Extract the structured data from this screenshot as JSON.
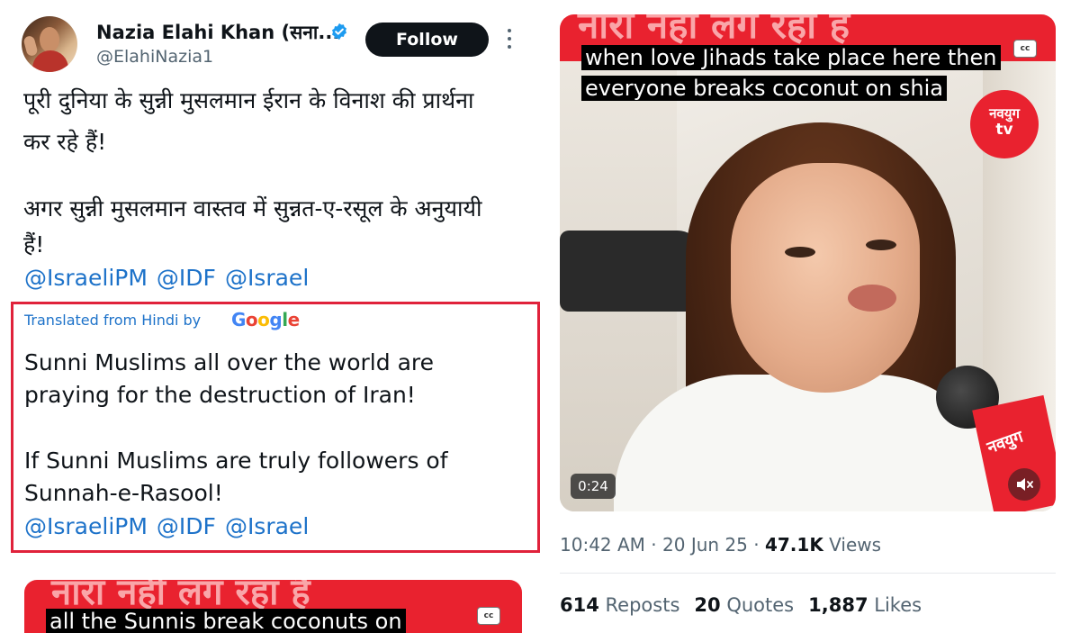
{
  "tweet": {
    "author_name": "Nazia Elahi Khan (सना...",
    "author_handle": "@ElahiNazia1",
    "follow_label": "Follow",
    "hindi_text": [
      "पूरी दुनिया के सुन्नी मुसलमान ईरान के विनाश की प्रार्थना",
      "कर रहे हैं!",
      "अगर सुन्नी मुसलमान वास्तव में सुन्नत-ए-रसूल के अनुयायी",
      "हैं!"
    ],
    "mentions": [
      "@IsraeliPM",
      "@IDF",
      "@Israel"
    ],
    "translated_label": "Translated from Hindi by",
    "translation_provider": "Google",
    "english_text": [
      "Sunni Muslims all over the world are",
      "praying for the destruction of Iran!",
      "If Sunni Muslims are truly followers of",
      "Sunnah-e-Rasool!"
    ]
  },
  "video": {
    "caption_line1": "when love Jihads take place here then",
    "caption_line2": "everyone breaks coconut on shia",
    "watermark_hindi": "नारा नहीं लग रहा है",
    "channel_logo_line1": "नवयुग",
    "channel_logo_line2": "tv",
    "mic_label": "नवयुग",
    "cc_label": "cc",
    "duration": "0:24"
  },
  "second_video": {
    "caption": "all the Sunnis break coconuts on",
    "watermark_hindi": "नारा नहीं लग रहा है",
    "cc_label": "cc"
  },
  "meta": {
    "time": "10:42 AM",
    "date": "20 Jun 25",
    "views_count": "47.1K",
    "views_label": "Views"
  },
  "stats": {
    "reposts_count": "614",
    "reposts_label": "Reposts",
    "quotes_count": "20",
    "quotes_label": "Quotes",
    "likes_count": "1,887",
    "likes_label": "Likes"
  },
  "colors": {
    "link_blue": "#1d72c9",
    "highlight_red": "#e0223b",
    "channel_red": "#e9222f",
    "text_dark": "#0f1419",
    "text_muted": "#536471"
  }
}
